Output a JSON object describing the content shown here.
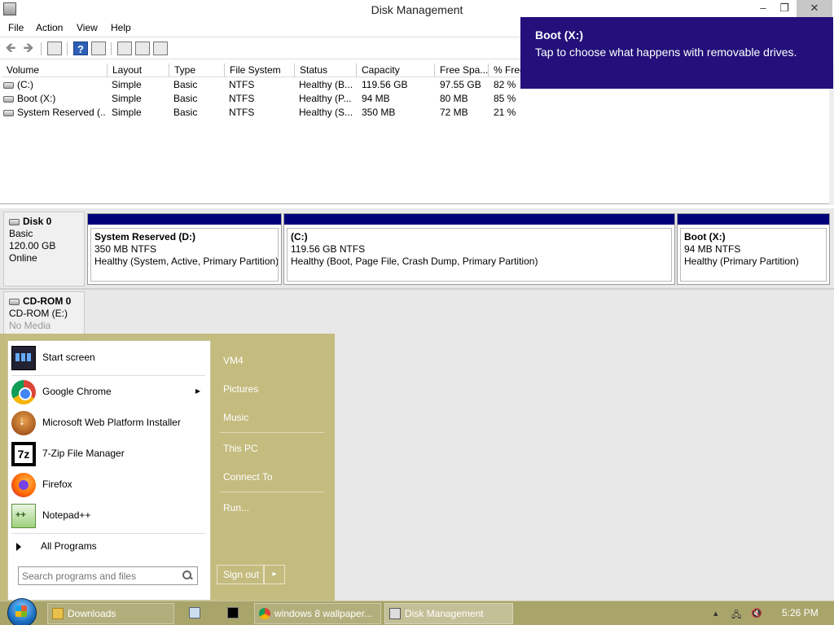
{
  "window": {
    "title": "Disk Management",
    "min_label": "–",
    "max_label": "❐",
    "close_label": "✕"
  },
  "menu": {
    "file": "File",
    "action": "Action",
    "view": "View",
    "help": "Help"
  },
  "toolbar": {
    "back": "🡸",
    "forward": "🡺",
    "help": "?"
  },
  "volume_list": {
    "columns": [
      "Volume",
      "Layout",
      "Type",
      "File System",
      "Status",
      "Capacity",
      "Free Spa...",
      "% Free"
    ],
    "rows": [
      [
        "(C:)",
        "Simple",
        "Basic",
        "NTFS",
        "Healthy (B...",
        "119.56 GB",
        "97.55 GB",
        "82 %"
      ],
      [
        "Boot (X:)",
        "Simple",
        "Basic",
        "NTFS",
        "Healthy (P...",
        "94 MB",
        "80 MB",
        "85 %"
      ],
      [
        "System Reserved (...",
        "Simple",
        "Basic",
        "NTFS",
        "Healthy (S...",
        "350 MB",
        "72 MB",
        "21 %"
      ]
    ]
  },
  "disks": {
    "disk0": {
      "name": "Disk 0",
      "type": "Basic",
      "size": "120.00 GB",
      "state": "Online"
    },
    "cdrom0": {
      "name": "CD-ROM 0",
      "drive": "CD-ROM (E:)",
      "media": "No Media"
    }
  },
  "partitions": [
    {
      "title": "System Reserved  (D:)",
      "size": "350 MB NTFS",
      "status": "Healthy (System, Active, Primary Partition)"
    },
    {
      "title": "(C:)",
      "size": "119.56 GB NTFS",
      "status": "Healthy (Boot, Page File, Crash Dump, Primary Partition)"
    },
    {
      "title": "Boot  (X:)",
      "size": "94 MB NTFS",
      "status": "Healthy (Primary Partition)"
    }
  ],
  "toast": {
    "title": "Boot (X:)",
    "message": "Tap to choose what happens with removable drives."
  },
  "start_menu": {
    "programs": [
      {
        "label": "Start screen",
        "icon": "start-screen-icon"
      },
      {
        "label": "Google Chrome",
        "icon": "chrome-icon",
        "submenu": "▸"
      },
      {
        "label": "Microsoft Web Platform Installer",
        "icon": "web-platform-installer-icon"
      },
      {
        "label": "7-Zip File Manager",
        "icon": "7zip-icon"
      },
      {
        "label": "Firefox",
        "icon": "firefox-icon"
      },
      {
        "label": "Notepad++",
        "icon": "notepad-plus-plus-icon"
      }
    ],
    "all_programs": "All Programs",
    "search_placeholder": "Search programs and files",
    "right_links": [
      "VM4",
      "Pictures",
      "Music",
      "This PC",
      "Connect To",
      "Run..."
    ],
    "sign_out": "Sign out",
    "sign_out_arrow": "▸"
  },
  "taskbar": {
    "items": [
      {
        "label": "Downloads",
        "icon": "folder-icon"
      },
      {
        "label": "windows 8 wallpaper...",
        "icon": "chrome-icon"
      },
      {
        "label": "Disk Management",
        "icon": "disk-management-icon"
      }
    ],
    "tray": {
      "chevron": "▴",
      "network": "🖧",
      "volume": "🔇"
    },
    "clock": "5:26 PM"
  }
}
